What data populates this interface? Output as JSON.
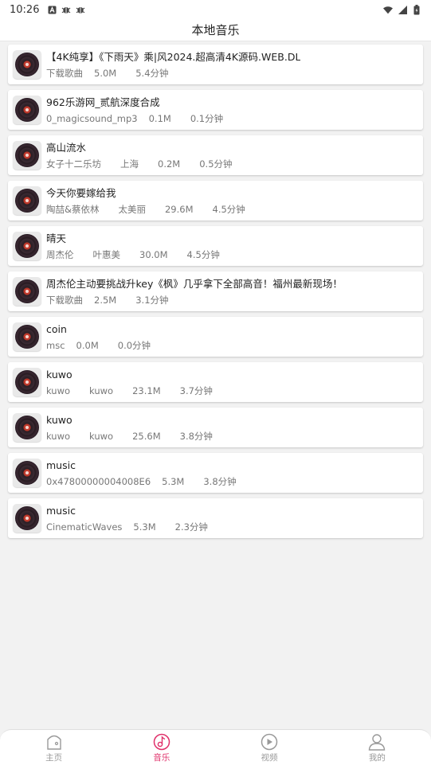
{
  "status_bar": {
    "time": "10:26"
  },
  "header": {
    "title": "本地音乐"
  },
  "songs": [
    {
      "title": "【4K纯享】《下雨天》乘|风2024.超高清4K源码.WEB.DL",
      "artist": "下载歌曲",
      "album": "",
      "size": "5.0M",
      "duration": "5.4分钟"
    },
    {
      "title": "962乐游网_贰航深度合成",
      "artist": "0_magicsound_mp3",
      "album": "",
      "size": "0.1M",
      "duration": "0.1分钟"
    },
    {
      "title": "高山流水",
      "artist": "女子十二乐坊",
      "album": "上海",
      "size": "0.2M",
      "duration": "0.5分钟"
    },
    {
      "title": "今天你要嫁给我",
      "artist": "陶喆&蔡依林",
      "album": "太美丽",
      "size": "29.6M",
      "duration": "4.5分钟"
    },
    {
      "title": "晴天",
      "artist": "周杰伦",
      "album": "叶惠美",
      "size": "30.0M",
      "duration": "4.5分钟"
    },
    {
      "title": "周杰伦主动要挑战升key《枫》几乎拿下全部高音！福州最新现场！",
      "artist": "下载歌曲",
      "album": "",
      "size": "2.5M",
      "duration": "3.1分钟"
    },
    {
      "title": "coin",
      "artist": "msc",
      "album": "",
      "size": "0.0M",
      "duration": "0.0分钟"
    },
    {
      "title": "kuwo",
      "artist": "kuwo",
      "album": "kuwo",
      "size": "23.1M",
      "duration": "3.7分钟"
    },
    {
      "title": "kuwo",
      "artist": "kuwo",
      "album": "kuwo",
      "size": "25.6M",
      "duration": "3.8分钟"
    },
    {
      "title": "music",
      "artist": "0x47800000004008E6",
      "album": "",
      "size": "5.3M",
      "duration": "3.8分钟"
    },
    {
      "title": "music",
      "artist": "CinematicWaves",
      "album": "",
      "size": "5.3M",
      "duration": "2.3分钟"
    }
  ],
  "nav": [
    {
      "label": "主页",
      "icon": "home-icon",
      "active": false
    },
    {
      "label": "音乐",
      "icon": "music-icon",
      "active": true
    },
    {
      "label": "视频",
      "icon": "video-play-icon",
      "active": false
    },
    {
      "label": "我的",
      "icon": "profile-icon",
      "active": false
    }
  ],
  "colors": {
    "accent": "#e0306a",
    "background": "#f2f2f2",
    "inactive": "#999999"
  }
}
